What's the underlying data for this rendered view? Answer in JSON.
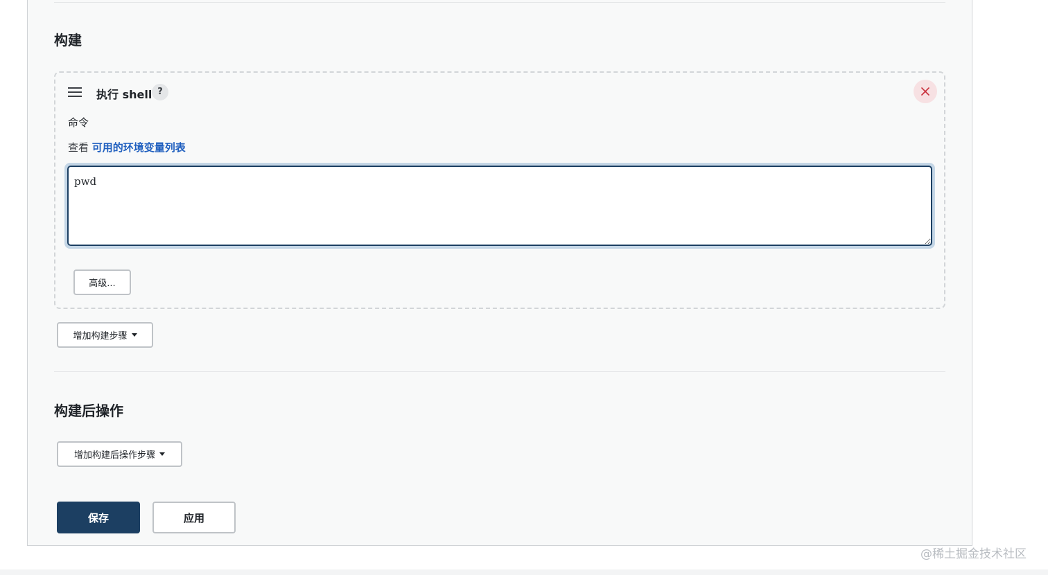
{
  "build_section": {
    "title": "构建",
    "step": {
      "title": "执行 shell",
      "help_icon": "?",
      "close_icon": "close-icon",
      "command_label": "命令",
      "env_prefix": "查看 ",
      "env_link": "可用的环境变量列表",
      "command_value": "pwd",
      "advanced_label": "高级..."
    },
    "add_step_label": "增加构建步骤"
  },
  "post_build_section": {
    "title": "构建后操作",
    "add_step_label": "增加构建后操作步骤"
  },
  "actions": {
    "save_label": "保存",
    "apply_label": "应用"
  },
  "watermark": "@稀土掘金技术社区",
  "colors": {
    "primary": "#1c3f62",
    "link": "#1f5fbf",
    "close_bg": "#f7e1e3",
    "close_x": "#c9303c",
    "focus_ring": "#c4d6e6"
  }
}
